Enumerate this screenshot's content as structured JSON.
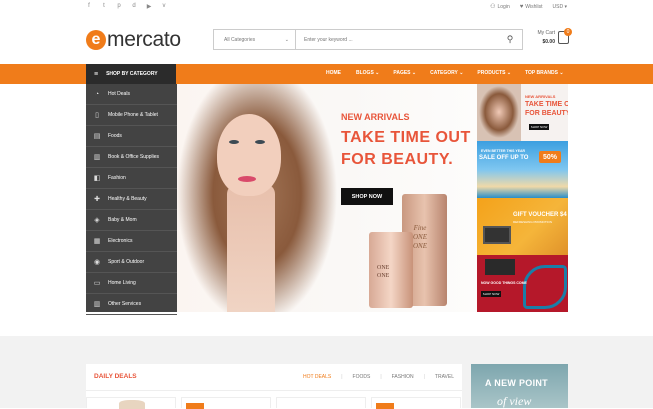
{
  "topbar": {
    "social_icons": [
      "facebook-icon",
      "twitter-icon",
      "pinterest-icon",
      "dribbble-icon",
      "youtube-icon",
      "vimeo-icon"
    ],
    "social_glyphs": [
      "f",
      "t",
      "p",
      "d",
      "▶",
      "v"
    ],
    "login": "Login",
    "wishlist": "Wishlist",
    "currency": "USD"
  },
  "header": {
    "logo_mark": "e",
    "logo_text": "mercato",
    "search": {
      "category": "All Categories",
      "placeholder": "Enter your keyword ..."
    },
    "cart": {
      "label": "My Cart",
      "amount": "$0.00",
      "count": "0"
    }
  },
  "nav": {
    "shop_by_category": "SHOP BY CATEGORY",
    "items": [
      {
        "label": "HOME",
        "active": true
      },
      {
        "label": "BLOGS"
      },
      {
        "label": "PAGES"
      },
      {
        "label": "CATEGORY"
      },
      {
        "label": "PRODUCTS"
      },
      {
        "label": "TOP BRANDS"
      }
    ]
  },
  "sidebar": {
    "items": [
      {
        "label": "Hot Deals",
        "icon": "tag-icon",
        "glyph": "◔"
      },
      {
        "label": "Mobile Phone & Tablet",
        "icon": "mobile-icon",
        "glyph": "▯"
      },
      {
        "label": "Foods",
        "icon": "food-icon",
        "glyph": "▤"
      },
      {
        "label": "Book & Office Supplies",
        "icon": "book-icon",
        "glyph": "▥"
      },
      {
        "label": "Fashion",
        "icon": "fashion-icon",
        "glyph": "◧"
      },
      {
        "label": "Healthy & Beauty",
        "icon": "health-icon",
        "glyph": "✚"
      },
      {
        "label": "Baby & Mom",
        "icon": "baby-icon",
        "glyph": "◈"
      },
      {
        "label": "Electronics",
        "icon": "electronics-icon",
        "glyph": "▦"
      },
      {
        "label": "Sport & Outdoor",
        "icon": "sport-icon",
        "glyph": "◉"
      },
      {
        "label": "Home Living",
        "icon": "home-icon",
        "glyph": "▭"
      },
      {
        "label": "Other Services",
        "icon": "services-icon",
        "glyph": "▥"
      }
    ]
  },
  "banner": {
    "small": "NEW ARRIVALS",
    "line1": "TAKE TIME OUT",
    "line2": "FOR BEAUTY.",
    "button": "SHOP NOW",
    "product_text1": "Fine\nONE\nONE",
    "product_text2": "ONE\nONE"
  },
  "side_ads": {
    "ad1_small": "NEW ARRIVALS",
    "ad1_big": "TAKE TIME OUT\nFOR BEAUTY.",
    "ad1_button": "SHOP NOW",
    "ad2_small": "EVEN BETTER THIS YEAR",
    "ad2_big": "SALE OFF UP TO",
    "ad2_pct": "50%",
    "ad3_big": "GIFT VOUCHER $4",
    "ad3_small": "REFRESHING PROMOTION",
    "ad4_text": "NOW GOOD THINGS COME",
    "ad4_button": "SHOP NOW"
  },
  "deals": {
    "title": "DAILY DEALS",
    "tabs": [
      {
        "label": "HOT DEALS",
        "active": true
      },
      {
        "label": "FOODS"
      },
      {
        "label": "FASHION"
      },
      {
        "label": "TRAVEL"
      }
    ]
  },
  "promo": {
    "line1": "A NEW POINT",
    "line2": "of view"
  }
}
